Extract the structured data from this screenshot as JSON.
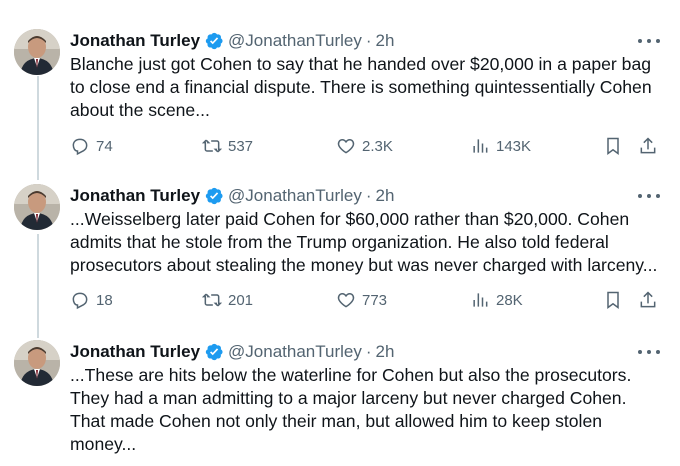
{
  "tweets": [
    {
      "name": "Jonathan Turley",
      "handle": "@JonathanTurley",
      "separator": "·",
      "time": "2h",
      "lines": [
        "Blanche just got Cohen to say that he handed over $20,000 in a paper bag",
        "to close end a financial dispute.  There is something quintessentially Cohen",
        "about the scene..."
      ],
      "replies": "74",
      "reposts": "537",
      "likes": "2.3K",
      "views": "143K"
    },
    {
      "name": "Jonathan Turley",
      "handle": "@JonathanTurley",
      "separator": "·",
      "time": "2h",
      "lines": [
        "...Weisselberg later paid Cohen for $60,000 rather than $20,000. Cohen",
        "admits that he stole from the Trump organization. He also told federal",
        "prosecutors about stealing the money but was never charged with larceny..."
      ],
      "replies": "18",
      "reposts": "201",
      "likes": "773",
      "views": "28K"
    },
    {
      "name": "Jonathan Turley",
      "handle": "@JonathanTurley",
      "separator": "·",
      "time": "2h",
      "lines": [
        "...These are hits below the waterline for Cohen but also the prosecutors.",
        "They had a man admitting to a major larceny but never charged Cohen.",
        "That made Cohen not only their man, but allowed him to keep stolen",
        "money..."
      ]
    }
  ],
  "colors": {
    "text": "#0f1419",
    "secondary": "#536471",
    "verified": "#1d9bf0",
    "thread_line": "#cfd9de"
  }
}
